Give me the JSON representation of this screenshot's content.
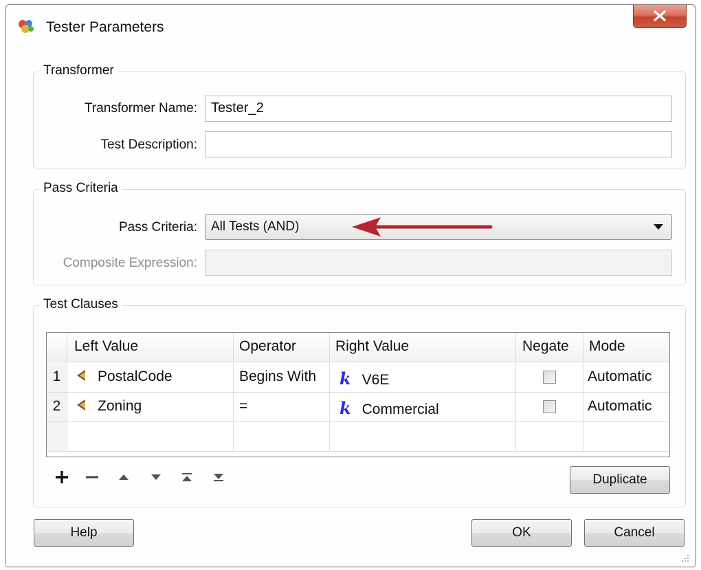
{
  "window": {
    "title": "Tester Parameters"
  },
  "transformer": {
    "legend": "Transformer",
    "name_label": "Transformer Name:",
    "name_value": "Tester_2",
    "description_label": "Test Description:",
    "description_value": ""
  },
  "pass_criteria": {
    "legend": "Pass Criteria",
    "criteria_label": "Pass Criteria:",
    "criteria_value": "All Tests (AND)",
    "composite_label": "Composite Expression:",
    "composite_value": ""
  },
  "test_clauses": {
    "legend": "Test Clauses",
    "columns": [
      "Left Value",
      "Operator",
      "Right Value",
      "Negate",
      "Mode"
    ],
    "rows": [
      {
        "num": "1",
        "left": "PostalCode",
        "operator": "Begins With",
        "right": "V6E",
        "negate": false,
        "mode": "Automatic"
      },
      {
        "num": "2",
        "left": "Zoning",
        "operator": "=",
        "right": "Commercial",
        "negate": false,
        "mode": "Automatic"
      }
    ],
    "toolbar_icons": [
      "add-icon",
      "remove-icon",
      "move-up-icon",
      "move-down-icon",
      "move-top-icon",
      "move-bottom-icon"
    ],
    "duplicate_label": "Duplicate"
  },
  "buttons": {
    "help": "Help",
    "ok": "OK",
    "cancel": "Cancel"
  },
  "colors": {
    "annotation_arrow": "#b3262e",
    "close_button": "#c4432e",
    "k_icon": "#2a2ad8"
  }
}
